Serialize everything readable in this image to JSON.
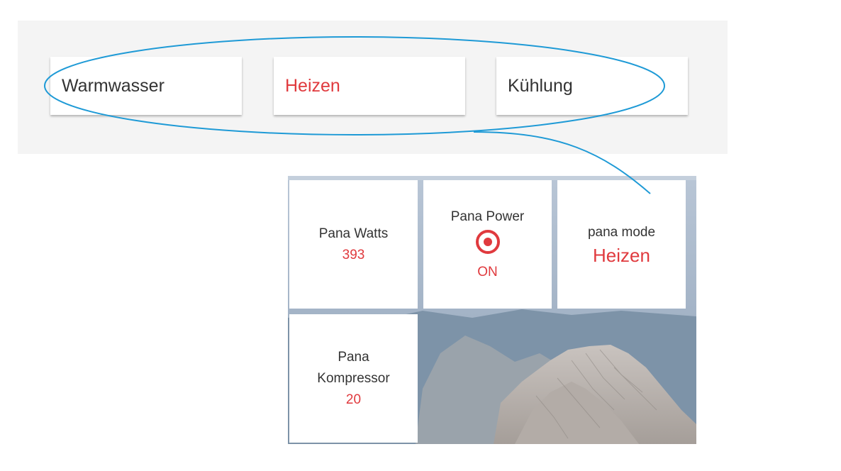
{
  "mode_buttons": [
    {
      "label": "Warmwasser",
      "active": false
    },
    {
      "label": "Heizen",
      "active": true
    },
    {
      "label": "Kühlung",
      "active": false
    }
  ],
  "tiles": {
    "watts": {
      "label": "Pana Watts",
      "value": "393"
    },
    "power": {
      "label": "Pana Power",
      "icon": "target-icon",
      "state": "ON"
    },
    "mode": {
      "label": "pana mode",
      "value": "Heizen"
    },
    "kompressor": {
      "label": "Pana Kompressor",
      "value": "20"
    }
  },
  "colors": {
    "accent": "#e03a3e",
    "annotation": "#1e9ad6",
    "panel_bg": "#f4f4f4",
    "text": "#333333"
  }
}
